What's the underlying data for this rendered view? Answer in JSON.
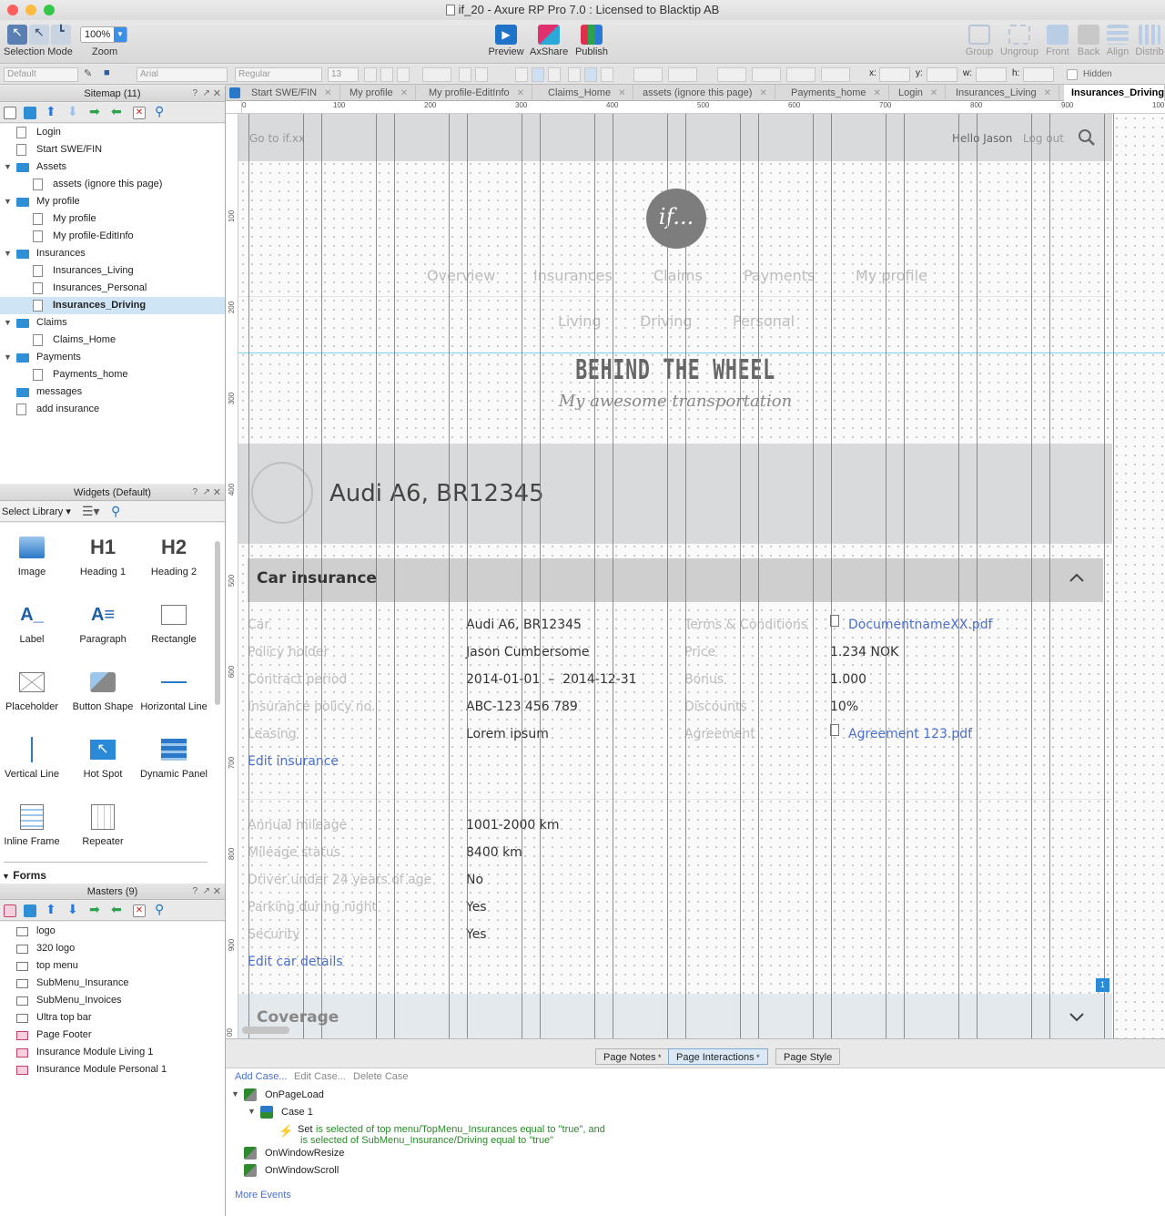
{
  "window": {
    "title": "if_20 - Axure RP Pro 7.0 : Licensed to Blacktip AB"
  },
  "toolbar": {
    "selection_mode": "Selection Mode",
    "zoom_label": "Zoom",
    "zoom_value": "100%",
    "preview": "Preview",
    "axshare": "AxShare",
    "publish": "Publish",
    "group": "Group",
    "ungroup": "Ungroup",
    "front": "Front",
    "back": "Back",
    "align": "Align",
    "distribute": "Distrib"
  },
  "formatbar": {
    "style": "Default",
    "font": "Arial",
    "weight": "Regular",
    "size": "13",
    "x_label": "x:",
    "y_label": "y:",
    "w_label": "w:",
    "h_label": "h:",
    "hidden_label": "Hidden"
  },
  "sitemap": {
    "title": "Sitemap (11)",
    "items": [
      {
        "label": "Login",
        "type": "page",
        "level": 0
      },
      {
        "label": "Start SWE/FIN",
        "type": "page",
        "level": 0
      },
      {
        "label": "Assets",
        "type": "folder",
        "level": 0
      },
      {
        "label": "assets (ignore this page)",
        "type": "page",
        "level": 1
      },
      {
        "label": "My profile",
        "type": "folder",
        "level": 0
      },
      {
        "label": "My profile",
        "type": "page",
        "level": 1
      },
      {
        "label": "My profile-EditInfo",
        "type": "page",
        "level": 1
      },
      {
        "label": "Insurances",
        "type": "folder",
        "level": 0
      },
      {
        "label": "Insurances_Living",
        "type": "page",
        "level": 1
      },
      {
        "label": "Insurances_Personal",
        "type": "page",
        "level": 1
      },
      {
        "label": "Insurances_Driving",
        "type": "page",
        "level": 1,
        "selected": true
      },
      {
        "label": "Claims",
        "type": "folder",
        "level": 0
      },
      {
        "label": "Claims_Home",
        "type": "page",
        "level": 1
      },
      {
        "label": "Payments",
        "type": "folder",
        "level": 0
      },
      {
        "label": "Payments_home",
        "type": "page",
        "level": 1
      },
      {
        "label": "messages",
        "type": "folder-closed",
        "level": 0
      },
      {
        "label": "add insurance",
        "type": "page",
        "level": 0
      }
    ]
  },
  "widgets": {
    "title": "Widgets (Default)",
    "select_library": "Select Library",
    "items": [
      "Image",
      "Heading 1",
      "Heading 2",
      "Label",
      "Paragraph",
      "Rectangle",
      "Placeholder",
      "Button Shape",
      "Horizontal Line",
      "Vertical Line",
      "Hot Spot",
      "Dynamic Panel",
      "Inline Frame",
      "Repeater"
    ],
    "h1_glyph": "H1",
    "h2_glyph": "H2",
    "forms_section": "Forms"
  },
  "masters": {
    "title": "Masters (9)",
    "items": [
      "logo",
      "320 logo",
      "top menu",
      "SubMenu_Insurance",
      "SubMenu_Invoices",
      "Ultra top bar",
      "Page Footer",
      "Insurance Module Living 1",
      "Insurance Module Personal 1"
    ]
  },
  "tabs": [
    "Start SWE/FIN",
    "My profile",
    "My profile-EditInfo",
    "Claims_Home",
    "assets (ignore this page)",
    "Payments_home",
    "Login",
    "Insurances_Living",
    "Insurances_Driving"
  ],
  "ruler": {
    "h": [
      "0",
      "100",
      "200",
      "300",
      "400",
      "500",
      "600",
      "700",
      "800",
      "900",
      "100"
    ],
    "v": [
      "100",
      "200",
      "300",
      "400",
      "500",
      "600",
      "700",
      "800",
      "900",
      "00"
    ]
  },
  "page": {
    "topbar": {
      "goto": "Go to if.xx",
      "hello": "Hello Jason",
      "logout": "Log out"
    },
    "logo_text": "if...",
    "menu": [
      "Overview",
      "Insurances",
      "Claims",
      "Payments",
      "My profile"
    ],
    "submenu": [
      "Living",
      "Driving",
      "Personal"
    ],
    "hero_title": "BEHIND THE WHEEL",
    "hero_subtitle": "My awesome transportation",
    "car_name": "Audi A6, BR12345",
    "car_insurance": {
      "title": "Car insurance",
      "left": [
        {
          "label": "Car",
          "value": "Audi A6, BR12345"
        },
        {
          "label": "Policy holder",
          "value": "Jason Cumbersome"
        },
        {
          "label": "Contract period",
          "value": "2014-01-01  –  2014-12-31"
        },
        {
          "label": "Insurance policy no.",
          "value": "ABC-123 456 789"
        },
        {
          "label": "Leasing",
          "value": "Lorem ipsum"
        }
      ],
      "right": [
        {
          "label": "Terms & Conditions",
          "value": "DocumentnameXX.pdf"
        },
        {
          "label": "Price",
          "value": "1.234 NOK"
        },
        {
          "label": "Bonus",
          "value": "1.000"
        },
        {
          "label": "Discounts",
          "value": "10%"
        },
        {
          "label": "Agreement",
          "value": "Agreement 123.pdf"
        }
      ],
      "edit_insurance": "Edit insurance",
      "details": [
        {
          "label": "Annual mileage",
          "value": "1001-2000 km"
        },
        {
          "label": "Mileage status",
          "value": "8400 km"
        },
        {
          "label": "Driver under 24 years of age",
          "value": "No"
        },
        {
          "label": "Parking during night",
          "value": "Yes"
        },
        {
          "label": "Security",
          "value": "Yes"
        }
      ],
      "edit_car": "Edit car details"
    },
    "coverage_title": "Coverage",
    "badge": "1"
  },
  "bottom": {
    "tabs": [
      "Page Notes",
      "Page Interactions",
      "Page Style"
    ],
    "actions": [
      "Add Case...",
      "Edit Case...",
      "Delete Case"
    ],
    "on_page_load": "OnPageLoad",
    "case1": "Case 1",
    "set_prefix": "Set",
    "set_line1": "is selected of top menu/TopMenu_Insurances equal to \"true\", and",
    "set_line2": "is selected of SubMenu_Insurance/Driving equal to \"true\"",
    "on_window_resize": "OnWindowResize",
    "on_window_scroll": "OnWindowScroll",
    "more_events": "More Events"
  },
  "colors": {
    "guide": "#d23cd8",
    "link": "#4a6fd0",
    "section_bg": "#d8d8d8",
    "selected_row": "#cfe5f5"
  }
}
